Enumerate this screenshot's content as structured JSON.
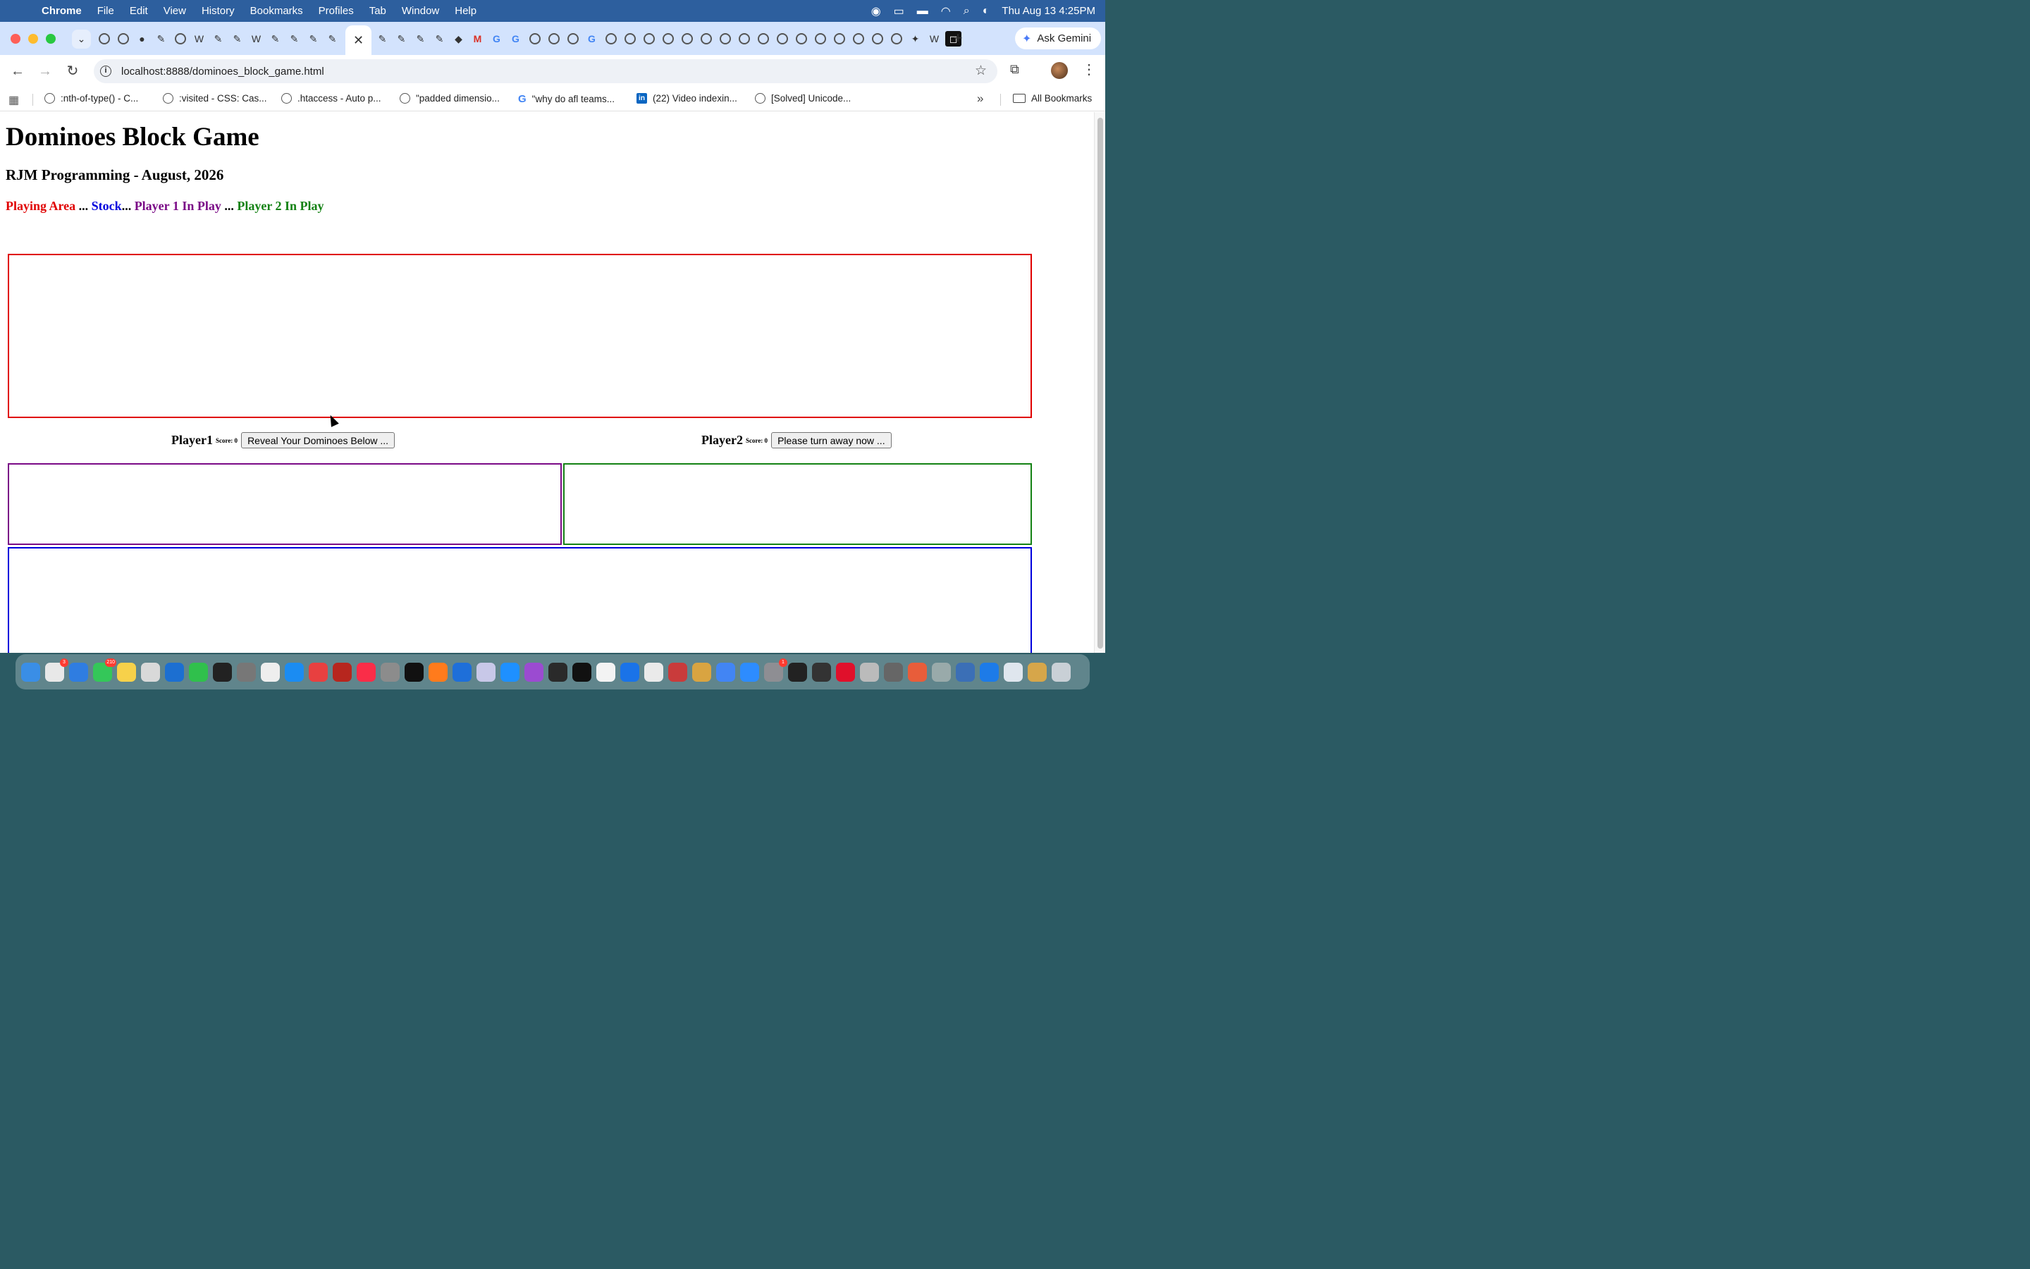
{
  "menubar": {
    "app": "Chrome",
    "items": [
      "File",
      "Edit",
      "View",
      "History",
      "Bookmarks",
      "Profiles",
      "Tab",
      "Window",
      "Help"
    ],
    "datetime": "Thu Aug 13  4:25PM"
  },
  "browser": {
    "ask_gemini": "Ask Gemini",
    "url": "localhost:8888/dominoes_block_game.html",
    "bookmarks": [
      {
        "label": ":nth-of-type() - C...",
        "icon": "globe"
      },
      {
        "label": ":visited - CSS: Cas...",
        "icon": "globe"
      },
      {
        "label": ".htaccess - Auto p...",
        "icon": "globe"
      },
      {
        "label": "\"padded dimensio...",
        "icon": "globe"
      },
      {
        "label": "\"why do afl teams...",
        "icon": "google"
      },
      {
        "label": "(22) Video indexin...",
        "icon": "linkedin"
      },
      {
        "label": "[Solved] Unicode...",
        "icon": "globe"
      }
    ],
    "all_bookmarks": "All Bookmarks"
  },
  "page": {
    "title": "Dominoes Block Game",
    "subtitle": "RJM Programming - August, 2026",
    "legend": {
      "playing_area": "Playing Area",
      "sep1": " ... ",
      "stock": "Stock",
      "sep2": "... ",
      "player1": "Player 1 In Play",
      "sep3": " ... ",
      "player2": "Player 2 In Play"
    },
    "player1": {
      "name": "Player1",
      "score": "Score: 0",
      "button": "Reveal Your Dominoes Below ..."
    },
    "player2": {
      "name": "Player2",
      "score": "Score: 0",
      "button": "Please turn away now ..."
    }
  },
  "colors": {
    "playing_area": "#e00000",
    "stock": "#0000dd",
    "player1": "#7a0a86",
    "player2": "#148214"
  }
}
